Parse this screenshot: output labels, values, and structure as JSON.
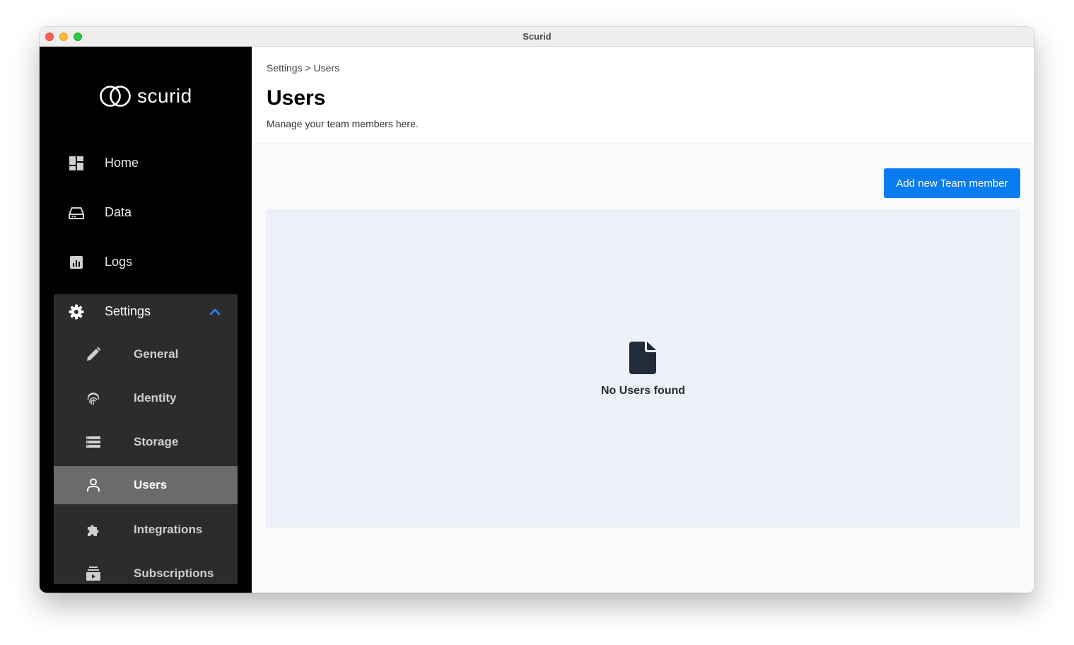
{
  "window": {
    "title": "Scurid"
  },
  "sidebar": {
    "logo_text": "scurid",
    "items": [
      {
        "label": "Home",
        "icon": "dashboard-icon"
      },
      {
        "label": "Data",
        "icon": "hard-drive-icon"
      },
      {
        "label": "Logs",
        "icon": "chart-icon"
      }
    ],
    "settings": {
      "label": "Settings",
      "icon": "gear-icon",
      "expanded": true,
      "accent": "#2f8cff",
      "subitems": [
        {
          "label": "General",
          "icon": "pencil-icon"
        },
        {
          "label": "Identity",
          "icon": "fingerprint-icon"
        },
        {
          "label": "Storage",
          "icon": "storage-icon"
        },
        {
          "label": "Users",
          "icon": "user-icon",
          "active": true
        },
        {
          "label": "Integrations",
          "icon": "puzzle-icon"
        },
        {
          "label": "Subscriptions",
          "icon": "subscriptions-icon"
        }
      ]
    }
  },
  "main": {
    "breadcrumb": "Settings > Users",
    "title": "Users",
    "subtitle": "Manage your team members here.",
    "add_button_label": "Add new Team member",
    "empty_state": {
      "icon": "file-icon",
      "text": "No Users found"
    }
  },
  "colors": {
    "sidebar_bg": "#000000",
    "settings_group_bg": "#2c2c2c",
    "active_item_bg": "#6b6b6b",
    "primary_button": "#0a7cf2",
    "empty_panel_bg": "#edf0f7"
  }
}
